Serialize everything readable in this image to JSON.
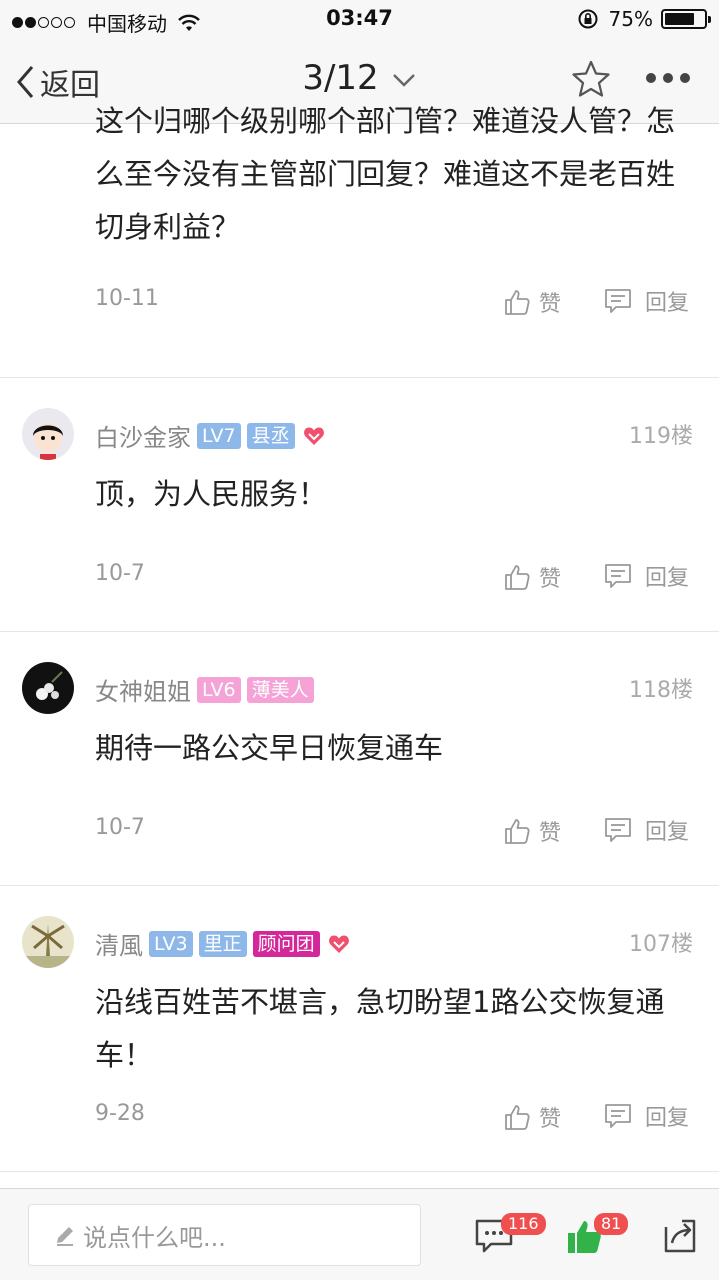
{
  "status_bar": {
    "carrier": "中国移动",
    "time": "03:47",
    "battery_pct": "75%",
    "battery_level": 0.75
  },
  "nav": {
    "back_label": "返回",
    "pager": "3/12"
  },
  "comments": [
    {
      "text": "这个归哪个级别哪个部门管？难道没人管？怎么至今没有主管部门回复？难道这不是老百姓切身利益？",
      "date": "10-11",
      "like_label": "赞",
      "reply_label": "回复"
    },
    {
      "user": "白沙金家",
      "level": "LV7",
      "title": "县丞",
      "floor": "119楼",
      "text": "顶，为人民服务！",
      "date": "10-7",
      "like_label": "赞",
      "reply_label": "回复"
    },
    {
      "user": "女神姐姐",
      "level": "LV6",
      "title": "薄美人",
      "floor": "118楼",
      "text": "期待一路公交早日恢复通车",
      "date": "10-7",
      "like_label": "赞",
      "reply_label": "回复"
    },
    {
      "user": "清風",
      "level": "LV3",
      "title": "里正",
      "extra_badge": "顾问团",
      "floor": "107楼",
      "text": "沿线百姓苦不堪言，急切盼望1路公交恢复通车！",
      "date": "9-28",
      "like_label": "赞",
      "reply_label": "回复"
    }
  ],
  "bottom": {
    "input_placeholder": "说点什么吧...",
    "comment_count": "116",
    "like_count": "81"
  },
  "colors": {
    "badge_blue": "#8fb8ea",
    "badge_pink": "#f5a3d6",
    "badge_magenta": "#d4289a",
    "heart_red": "#f0506e",
    "like_green": "#32b34a",
    "count_red": "#f04f4f"
  }
}
